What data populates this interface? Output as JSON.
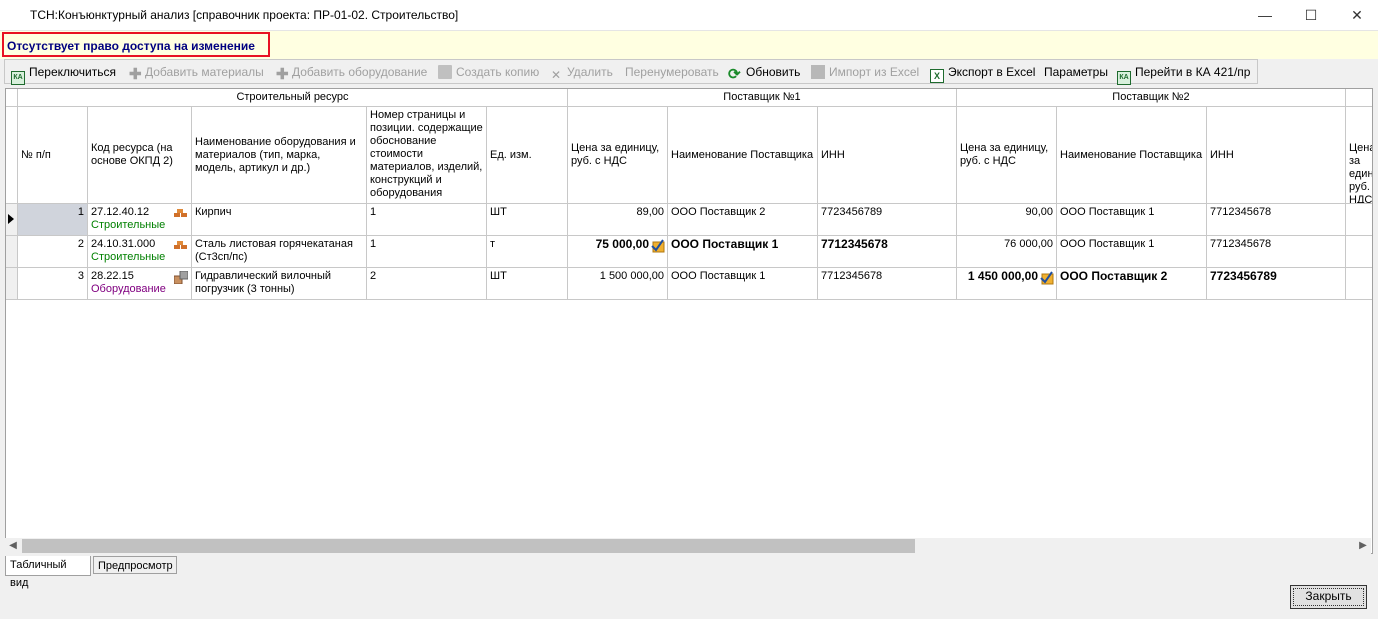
{
  "window": {
    "title": "ТСН:Конъюнктурный анализ [справочник проекта: ПР-01-02. Строительство]",
    "minimize": "—",
    "maximize": "☐",
    "close": "✕"
  },
  "warning": "Отсутствует право доступа на изменение",
  "toolbar": {
    "switch": "Переключиться",
    "add_materials": "Добавить материалы",
    "add_equipment": "Добавить оборудование",
    "create_copy": "Создать копию",
    "delete": "Удалить",
    "renumber": "Перенумеровать",
    "refresh": "Обновить",
    "import_excel": "Импорт из Excel",
    "export_excel": "Экспорт в Excel",
    "params": "Параметры",
    "goto_ka": "Перейти в КА 421/пр"
  },
  "grid": {
    "group_resource": "Строительный ресурс",
    "group_supplier1": "Поставщик №1",
    "group_supplier2": "Поставщик №2",
    "col_num": "№ п/п",
    "col_code": "Код ресурса (на основе ОКПД 2)",
    "col_name": "Наименование оборудования и материалов (тип, марка, модель, артикул и др.)",
    "col_page": "Номер страницы и позиции. содержащие обоснование стоимости материалов, изделий, конструкций и оборудования",
    "col_unit": "Ед. изм.",
    "col_price1": "Цена за единицу, руб. с НДС",
    "col_supplier1": "Наименование Поставщика",
    "col_inn1": "ИНН",
    "col_price2": "Цена за единицу, руб. с НДС",
    "col_supplier2": "Наименование Поставщика",
    "col_inn2": "ИНН",
    "col_price3": "Цена за единицу, руб. с НДС",
    "rows": [
      {
        "num": "1",
        "code": "27.12.40.12",
        "category": "Строительные",
        "name": "Кирпич",
        "page": "1",
        "unit": "ШТ",
        "price1": "89,00",
        "supplier1": "ООО Поставщик 2",
        "inn1": "7723456789",
        "price2": "90,00",
        "supplier2": "ООО Поставщик 1",
        "inn2": "7712345678"
      },
      {
        "num": "2",
        "code": "24.10.31.000",
        "category": "Строительные",
        "name": "Сталь листовая горячекатаная (Ст3сп/пс)",
        "page": "1",
        "unit": "т",
        "price1": "75 000,00",
        "supplier1": "ООО Поставщик 1",
        "inn1": "7712345678",
        "price2": "76 000,00",
        "supplier2": "ООО Поставщик 1",
        "inn2": "7712345678"
      },
      {
        "num": "3",
        "code": "28.22.15",
        "category": "Оборудование",
        "name": "Гидравлический вилочный погрузчик (3 тонны)",
        "page": "2",
        "unit": "ШТ",
        "price1": "1 500 000,00",
        "supplier1": "ООО Поставщик 1",
        "inn1": "7712345678",
        "price2": "1 450 000,00",
        "supplier2": "ООО Поставщик 2",
        "inn2": "7723456789"
      }
    ]
  },
  "tabs": {
    "table_view": "Табличный вид",
    "preview": "Предпросмотр"
  },
  "close_button": "Закрыть"
}
